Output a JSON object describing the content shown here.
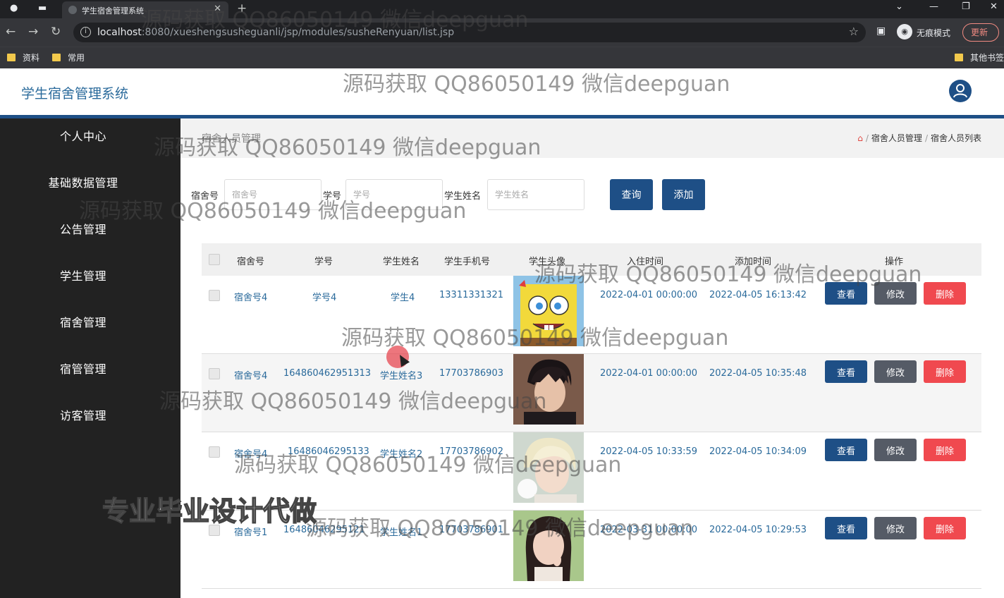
{
  "browser": {
    "tab_title": "学生宿舍管理系统",
    "url_host": "localhost",
    "url_path": ":8080/xueshengsusheguanli/jsp/modules/susheRenyuan/list.jsp",
    "incognito_label": "无痕模式",
    "update_label": "更新",
    "bookmarks": [
      "资料",
      "常用"
    ],
    "other_bookmarks": "其他书签"
  },
  "app": {
    "title": "学生宿舍管理系统"
  },
  "sidebar": {
    "items": [
      {
        "label": "个人中心"
      },
      {
        "label": "基础数据管理"
      },
      {
        "label": "公告管理"
      },
      {
        "label": "学生管理"
      },
      {
        "label": "宿舍管理"
      },
      {
        "label": "宿管管理"
      },
      {
        "label": "访客管理"
      }
    ]
  },
  "page": {
    "heading": "宿舍人员管理",
    "breadcrumb": [
      "宿舍人员管理",
      "宿舍人员列表"
    ]
  },
  "search": {
    "dorm_label": "宿舍号",
    "dorm_placeholder": "宿舍号",
    "studentno_label": "学号",
    "studentno_placeholder": "学号",
    "name_label": "学生姓名",
    "name_placeholder": "学生姓名",
    "query_label": "查询",
    "add_label": "添加"
  },
  "table": {
    "headers": [
      "宿舍号",
      "学号",
      "学生姓名",
      "学生手机号",
      "学生头像",
      "入住时间",
      "添加时间",
      "操作"
    ],
    "rows": [
      {
        "dorm": "宿舍号4",
        "student_no": "学号4",
        "name": "学生4",
        "phone": "13311331321",
        "avatar": "spongebob",
        "checkin": "2022-04-01 00:00:00",
        "added": "2022-04-05 16:13:42"
      },
      {
        "dorm": "宿舍号4",
        "student_no": "164860462951313",
        "name": "学生姓名3",
        "phone": "17703786903",
        "avatar": "dark-hair-man",
        "checkin": "2022-04-01 00:00:00",
        "added": "2022-04-05 10:35:48"
      },
      {
        "dorm": "宿舍号4",
        "student_no": "16486046295133",
        "name": "学生姓名2",
        "phone": "17703786902",
        "avatar": "blonde-person",
        "checkin": "2022-04-05 10:33:59",
        "added": "2022-04-05 10:34:09"
      },
      {
        "dorm": "宿舍号1",
        "student_no": "16486046295121",
        "name": "学生姓名1",
        "phone": "17703786901",
        "avatar": "girl-portrait",
        "checkin": "2022-03-31 00:00:00",
        "added": "2022-04-05 10:29:53"
      }
    ],
    "view_label": "查看",
    "edit_label": "修改",
    "delete_label": "删除"
  },
  "overlay": {
    "watermark": "源码获取 QQ86050149 微信deepguan",
    "promo": "专业毕业设计代做"
  },
  "colors": {
    "primary": "#1e4f86",
    "danger": "#f0494f",
    "secondary": "#555b66",
    "sidebar": "#222222"
  }
}
